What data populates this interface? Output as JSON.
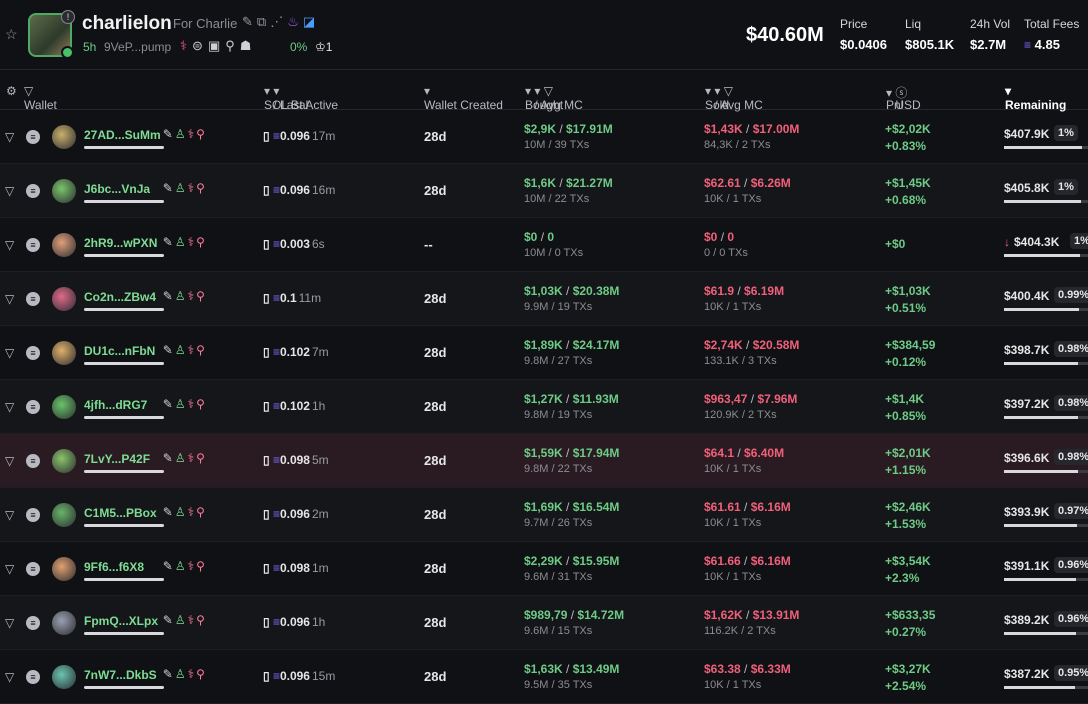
{
  "token": {
    "name": "charlielon",
    "for": "For Charlie",
    "age": "5h",
    "address": "9VeP...pump",
    "holder_pct": "0%",
    "holders": "1"
  },
  "stats": {
    "market_cap": "$40.60M",
    "price_label": "Price",
    "price": "$0.0406",
    "liq_label": "Liq",
    "liq": "$805.1K",
    "vol_label": "24h Vol",
    "vol": "$2.7M",
    "fees_label": "Total Fees",
    "fees": "4.85"
  },
  "columns": {
    "wallet": "Wallet",
    "sol_bal": "SOL Bal",
    "last_active": "/ Last Active",
    "created": "Wallet Created",
    "bought": "Bought",
    "avg_mc_b": "/ Avg MC",
    "sold": "Sold",
    "avg_mc_s": "/ Avg MC",
    "pnl": "Pnl",
    "usd": "USD",
    "remaining": "Remaining"
  },
  "colors": {
    "accent_green": "#6ecb86",
    "accent_red": "#f0607a",
    "sol_purple": "#7c6bff"
  },
  "rows": [
    {
      "wallet": "27AD...SuMm",
      "sol": "0.096",
      "last": "17m",
      "created": "28d",
      "bought": "$2,9K",
      "bought_mc": "$17.91M",
      "bought_sub": "10M / 39 TXs",
      "sold": "$1,43K",
      "sold_mc": "$17.00M",
      "sold_sub": "84,3K / 2 TXs",
      "pnl": "+$2,02K",
      "pnl_pct": "+0.83%",
      "remaining": "$407.9K",
      "rem_pct": "1%",
      "fill": 0.93,
      "avatar": "#c9b06a"
    },
    {
      "wallet": "J6bc...VnJa",
      "sol": "0.096",
      "last": "16m",
      "created": "28d",
      "bought": "$1,6K",
      "bought_mc": "$21.27M",
      "bought_sub": "10M / 22 TXs",
      "sold": "$62.61",
      "sold_mc": "$6.26M",
      "sold_sub": "10K / 1 TXs",
      "pnl": "+$1,45K",
      "pnl_pct": "+0.68%",
      "remaining": "$405.8K",
      "rem_pct": "1%",
      "fill": 0.92,
      "avatar": "#79c46a"
    },
    {
      "wallet": "2hR9...wPXN",
      "sol": "0.003",
      "last": "6s",
      "created": "--",
      "bought": "$0",
      "bought_mc": "0",
      "bought_sub": "10M / 0 TXs",
      "sold": "$0",
      "sold_mc": "0",
      "sold_sub": "0 / 0 TXs",
      "pnl": "+$0",
      "pnl_pct": "",
      "remaining": "$404.3K",
      "rem_pct": "1%",
      "fill": 0.9,
      "avatar": "#e0a07a",
      "down": true
    },
    {
      "wallet": "Co2n...ZBw4",
      "sol": "0.1",
      "last": "11m",
      "created": "28d",
      "bought": "$1,03K",
      "bought_mc": "$20.38M",
      "bought_sub": "9.9M / 19 TXs",
      "sold": "$61.9",
      "sold_mc": "$6.19M",
      "sold_sub": "10K / 1 TXs",
      "pnl": "+$1,03K",
      "pnl_pct": "+0.51%",
      "remaining": "$400.4K",
      "rem_pct": "0.99%",
      "fill": 0.89,
      "avatar": "#e06a8a"
    },
    {
      "wallet": "DU1c...nFbN",
      "sol": "0.102",
      "last": "7m",
      "created": "28d",
      "bought": "$1,89K",
      "bought_mc": "$24.17M",
      "bought_sub": "9.8M / 27 TXs",
      "sold": "$2,74K",
      "sold_mc": "$20.58M",
      "sold_sub": "133.1K / 3 TXs",
      "pnl": "+$384,59",
      "pnl_pct": "+0.12%",
      "remaining": "$398.7K",
      "rem_pct": "0.98%",
      "fill": 0.88,
      "avatar": "#e0b06a"
    },
    {
      "wallet": "4jfh...dRG7",
      "sol": "0.102",
      "last": "1h",
      "created": "28d",
      "bought": "$1,27K",
      "bought_mc": "$11.93M",
      "bought_sub": "9.8M / 19 TXs",
      "sold": "$963,47",
      "sold_mc": "$7.96M",
      "sold_sub": "120.9K / 2 TXs",
      "pnl": "+$1,4K",
      "pnl_pct": "+0.85%",
      "remaining": "$397.2K",
      "rem_pct": "0.98%",
      "fill": 0.88,
      "avatar": "#6ac46a"
    },
    {
      "wallet": "7LvY...P42F",
      "sol": "0.098",
      "last": "5m",
      "created": "28d",
      "bought": "$1,59K",
      "bought_mc": "$17.94M",
      "bought_sub": "9.8M / 22 TXs",
      "sold": "$64.1",
      "sold_mc": "$6.40M",
      "sold_sub": "10K / 1 TXs",
      "pnl": "+$2,01K",
      "pnl_pct": "+1.15%",
      "remaining": "$396.6K",
      "rem_pct": "0.98%",
      "fill": 0.88,
      "avatar": "#8ac46a",
      "hl": true
    },
    {
      "wallet": "C1M5...PBox",
      "sol": "0.096",
      "last": "2m",
      "created": "28d",
      "bought": "$1,69K",
      "bought_mc": "$16.54M",
      "bought_sub": "9.7M / 26 TXs",
      "sold": "$61.61",
      "sold_mc": "$6.16M",
      "sold_sub": "10K / 1 TXs",
      "pnl": "+$2,46K",
      "pnl_pct": "+1.53%",
      "remaining": "$393.9K",
      "rem_pct": "0.97%",
      "fill": 0.87,
      "avatar": "#6ab46a"
    },
    {
      "wallet": "9Ff6...f6X8",
      "sol": "0.098",
      "last": "1m",
      "created": "28d",
      "bought": "$2,29K",
      "bought_mc": "$15.95M",
      "bought_sub": "9.6M / 31 TXs",
      "sold": "$61.66",
      "sold_mc": "$6.16M",
      "sold_sub": "10K / 1 TXs",
      "pnl": "+$3,54K",
      "pnl_pct": "+2.3%",
      "remaining": "$391.1K",
      "rem_pct": "0.96%",
      "fill": 0.86,
      "avatar": "#e0a070"
    },
    {
      "wallet": "FpmQ...XLpx",
      "sol": "0.096",
      "last": "1h",
      "created": "28d",
      "bought": "$989,79",
      "bought_mc": "$14.72M",
      "bought_sub": "9.6M / 15 TXs",
      "sold": "$1,62K",
      "sold_mc": "$13.91M",
      "sold_sub": "116.2K / 2 TXs",
      "pnl": "+$633,35",
      "pnl_pct": "+0.27%",
      "remaining": "$389.2K",
      "rem_pct": "0.96%",
      "fill": 0.86,
      "avatar": "#9aa0b0"
    },
    {
      "wallet": "7nW7...DkbS",
      "sol": "0.096",
      "last": "15m",
      "created": "28d",
      "bought": "$1,63K",
      "bought_mc": "$13.49M",
      "bought_sub": "9.5M / 35 TXs",
      "sold": "$63.38",
      "sold_mc": "$6.33M",
      "sold_sub": "10K / 1 TXs",
      "pnl": "+$3,27K",
      "pnl_pct": "+2.54%",
      "remaining": "$387.2K",
      "rem_pct": "0.95%",
      "fill": 0.85,
      "avatar": "#6ac4b0"
    }
  ]
}
